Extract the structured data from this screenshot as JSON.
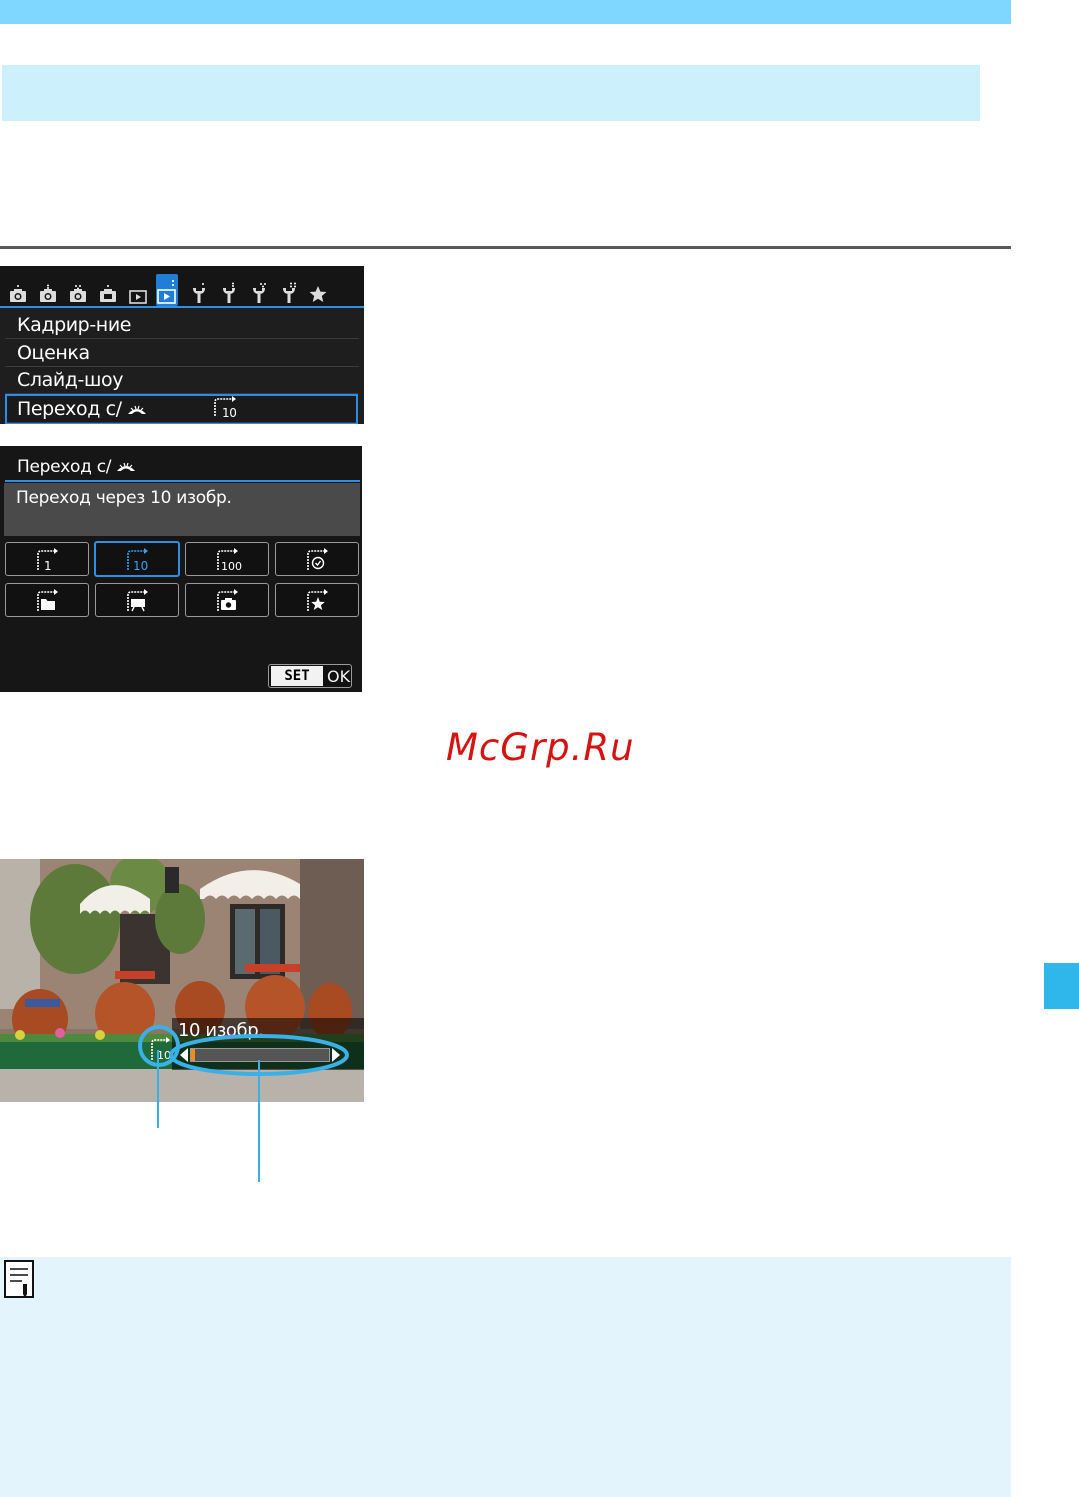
{
  "colors": {
    "band_top": "#7fd7ff",
    "band_header": "#cdf0fd",
    "accent_blue": "#2f8fe4",
    "note_bg": "#e4f4fd",
    "watermark": "#d41313"
  },
  "menu_screen": {
    "tabs": [
      "camera-1-icon",
      "camera-2-icon",
      "camera-3-icon",
      "camera-4-icon",
      "playback-1-icon",
      "playback-2-icon",
      "setup-1-icon",
      "setup-2-icon",
      "setup-3-icon",
      "setup-4-icon",
      "my-menu-star-icon"
    ],
    "items": [
      {
        "label": "Кадрир-ние",
        "value": ""
      },
      {
        "label": "Оценка",
        "value": ""
      },
      {
        "label": "Слайд-шоу",
        "value": ""
      },
      {
        "label": "Переход с/ ",
        "value": "10",
        "selected": true
      }
    ]
  },
  "jump_screen": {
    "title": "Переход с/ ",
    "description": "Переход через 10 изобр.",
    "options": [
      {
        "icon": "jump-1-icon",
        "label": "1"
      },
      {
        "icon": "jump-10-icon",
        "label": "10",
        "selected": true
      },
      {
        "icon": "jump-100-icon",
        "label": "100"
      },
      {
        "icon": "jump-date-icon",
        "label": ""
      },
      {
        "icon": "jump-folder-icon",
        "label": ""
      },
      {
        "icon": "jump-movie-icon",
        "label": ""
      },
      {
        "icon": "jump-stills-icon",
        "label": ""
      },
      {
        "icon": "jump-rating-icon",
        "label": ""
      }
    ],
    "set_label": "SET",
    "ok_label": "OK"
  },
  "watermark": "McGrp.Ru",
  "playback": {
    "jump_text": "10 изобр.",
    "jump_icon_label": "10",
    "progress_fraction": 0.03
  }
}
